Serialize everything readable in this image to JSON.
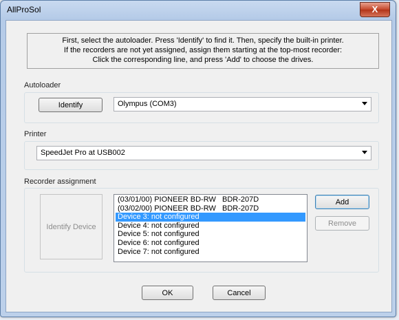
{
  "window": {
    "title": "AllProSol",
    "close_label": "X"
  },
  "instructions": [
    "First, select the autoloader. Press 'Identify' to find it. Then, specify the built-in printer.",
    "If the recorders are not yet assigned, assign them starting at the top-most recorder:",
    "Click the corresponding line, and press 'Add' to choose the drives."
  ],
  "autoloader": {
    "label": "Autoloader",
    "identify_label": "Identify",
    "selected": "Olympus (COM3)"
  },
  "printer": {
    "label": "Printer",
    "selected": "SpeedJet Pro at USB002"
  },
  "recorder": {
    "label": "Recorder assignment",
    "identify_device_label": "Identify Device",
    "add_label": "Add",
    "remove_label": "Remove",
    "items": [
      "(03/01/00) PIONEER BD-RW   BDR-207D",
      "(03/02/00) PIONEER BD-RW   BDR-207D",
      "Device 3: not configured",
      "Device 4: not configured",
      "Device 5: not configured",
      "Device 6: not configured",
      "Device 7: not configured"
    ],
    "selected_index": 2
  },
  "footer": {
    "ok_label": "OK",
    "cancel_label": "Cancel"
  },
  "colors": {
    "selection": "#3399ff",
    "close_button": "#c4472a"
  }
}
